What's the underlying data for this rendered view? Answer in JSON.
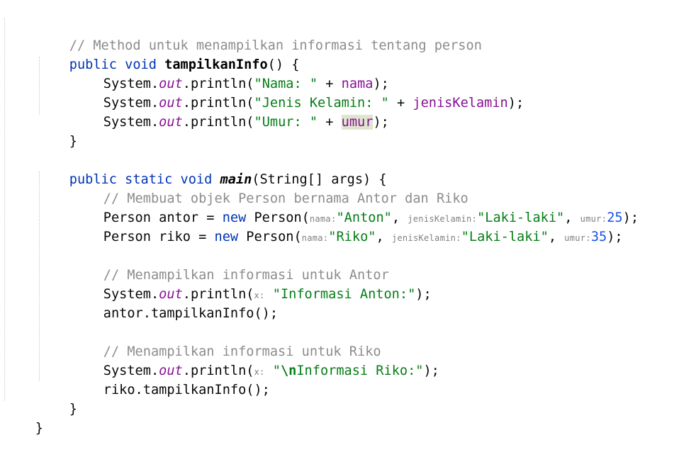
{
  "code": {
    "l1_comment": "// Method untuk menampilkan informasi tentang person",
    "l2_public": "public",
    "l2_void": "void",
    "l2_name": "tampilkanInfo",
    "l2_rest": "() {",
    "l3_sys": "System.",
    "l3_out": "out",
    "l3_call": ".println(",
    "l3_str": "\"Nama: \"",
    "l3_plus": " + ",
    "l3_field": "nama",
    "l3_end": ");",
    "l4_sys": "System.",
    "l4_out": "out",
    "l4_call": ".println(",
    "l4_str": "\"Jenis Kelamin: \"",
    "l4_plus": " + ",
    "l4_field": "jenisKelamin",
    "l4_end": ");",
    "l5_sys": "System.",
    "l5_out": "out",
    "l5_call": ".println(",
    "l5_str": "\"Umur: \"",
    "l5_plus": " + ",
    "l5_field": "umur",
    "l5_end": ");",
    "l6_brace": "}",
    "l8_public": "public",
    "l8_static": "static",
    "l8_void": "void",
    "l8_main": "main",
    "l8_rest": "(String[] args) {",
    "l9_comment": "// Membuat objek Person bernama Antor dan Riko",
    "l10_pre": "Person antor = ",
    "l10_new": "new",
    "l10_cls": " Person(",
    "l10_h1": "nama:",
    "l10_s1": "\"Anton\"",
    "l10_c1": ", ",
    "l10_h2": "jenisKelamin:",
    "l10_s2": "\"Laki-laki\"",
    "l10_c2": ", ",
    "l10_h3": "umur:",
    "l10_n": "25",
    "l10_end": ");",
    "l11_pre": "Person riko = ",
    "l11_new": "new",
    "l11_cls": " Person(",
    "l11_h1": "nama:",
    "l11_s1": "\"Riko\"",
    "l11_c1": ", ",
    "l11_h2": "jenisKelamin:",
    "l11_s2": "\"Laki-laki\"",
    "l11_c2": ", ",
    "l11_h3": "umur:",
    "l11_n": "35",
    "l11_end": ");",
    "l13_comment": "// Menampilkan informasi untuk Antor",
    "l14_sys": "System.",
    "l14_out": "out",
    "l14_call": ".println(",
    "l14_hint": "x:",
    "l14_str": "\"Informasi Anton:\"",
    "l14_end": ");",
    "l15_text": "antor.tampilkanInfo();",
    "l17_comment": "// Menampilkan informasi untuk Riko",
    "l18_sys": "System.",
    "l18_out": "out",
    "l18_call": ".println(",
    "l18_hint": "x:",
    "l18_q": "\"",
    "l18_esc": "\\n",
    "l18_str": "Informasi Riko:\"",
    "l18_end": ");",
    "l19_text": "riko.tampilkanInfo();",
    "l20_brace": "}",
    "l21_brace": "}"
  },
  "colors": {
    "keyword": "#0033b3",
    "comment": "#8c8c8c",
    "string": "#067d17",
    "field": "#871094",
    "highlight": "#dfe6cf"
  }
}
